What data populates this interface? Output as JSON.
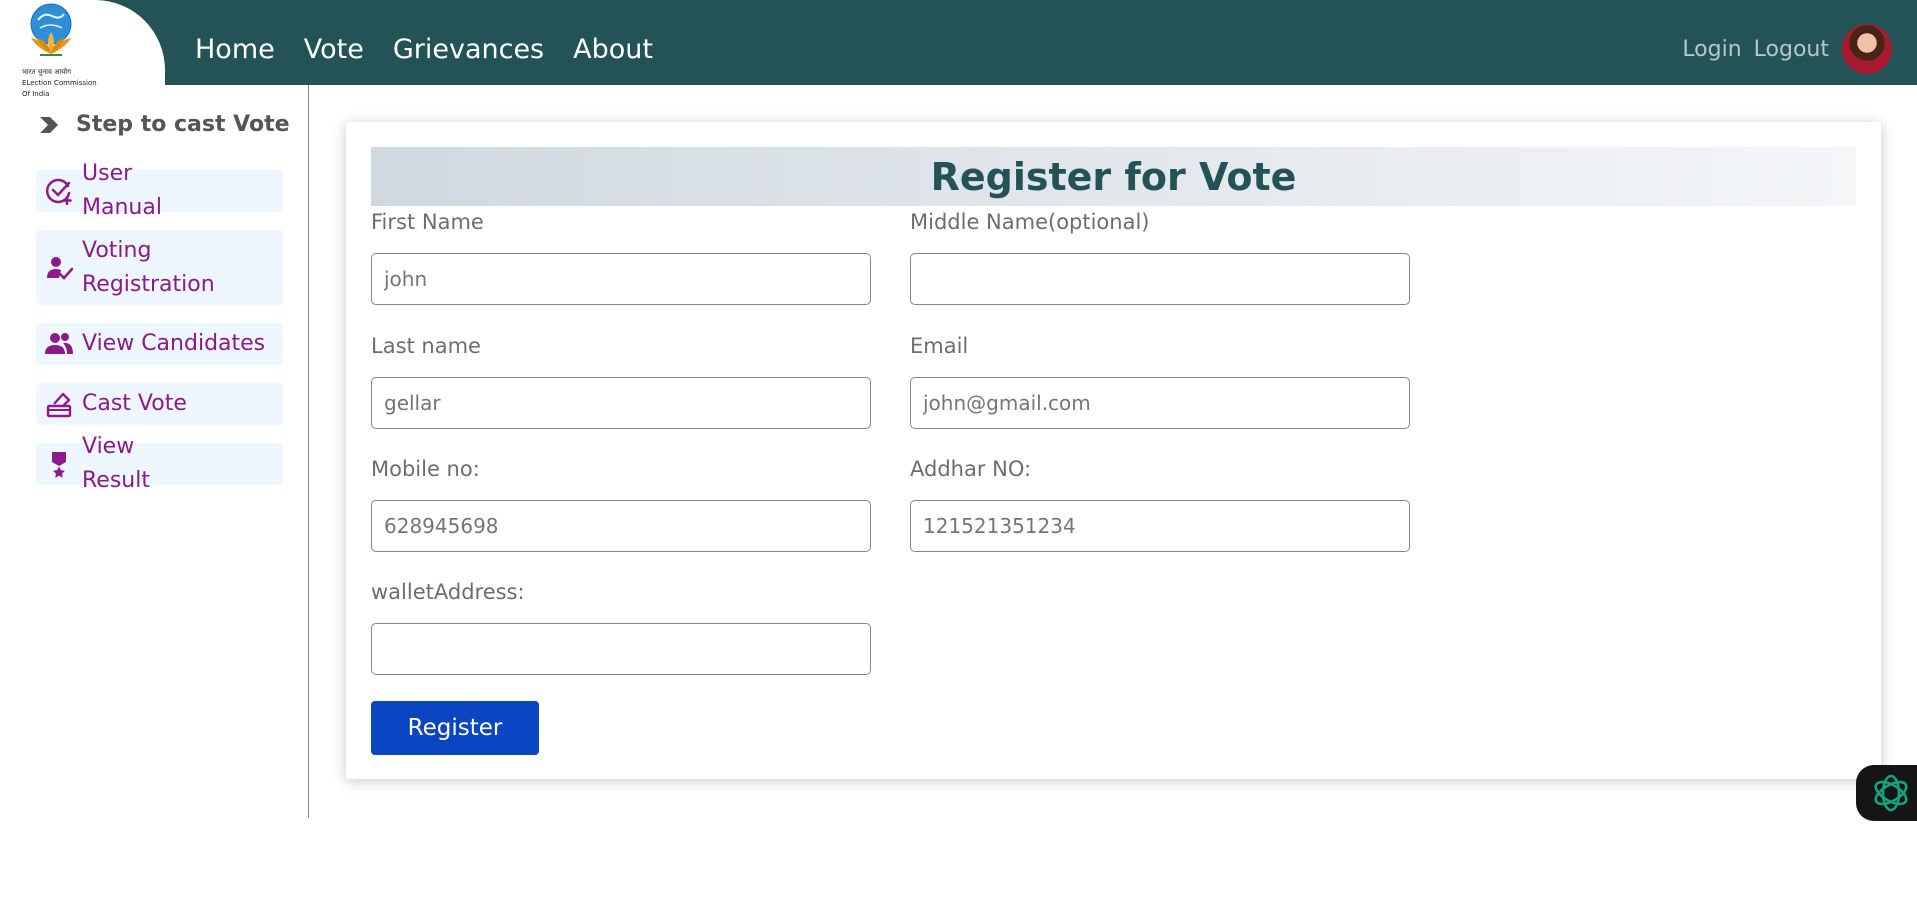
{
  "brand": {
    "logo_line1": "भारत चुनाव आयोग",
    "logo_line2": "ELection Commission",
    "logo_line3": "Of India"
  },
  "nav": {
    "links": [
      "Home",
      "Vote",
      "Grievances",
      "About"
    ],
    "login": "Login",
    "logout": "Logout"
  },
  "sidebar": {
    "title": "Step to cast Vote",
    "items": [
      {
        "label": "User Manual",
        "icon": "check-circle-plus-icon"
      },
      {
        "label": "Voting Registration",
        "icon": "user-check-icon"
      },
      {
        "label": "View Candidates",
        "icon": "users-icon"
      },
      {
        "label": "Cast Vote",
        "icon": "ballot-box-icon"
      },
      {
        "label": "View Result",
        "icon": "medal-icon"
      }
    ]
  },
  "form": {
    "title": "Register for Vote",
    "first_name": {
      "label": "First Name",
      "placeholder": "john"
    },
    "middle_name": {
      "label": "Middle Name(optional)",
      "placeholder": ""
    },
    "last_name": {
      "label": "Last name",
      "placeholder": "gellar"
    },
    "email": {
      "label": "Email",
      "placeholder": "john@gmail.com"
    },
    "mobile": {
      "label": "Mobile no:",
      "placeholder": "628945698"
    },
    "aadhar": {
      "label": "Addhar NO:",
      "placeholder": "121521351234"
    },
    "wallet": {
      "label": "walletAddress:",
      "placeholder": ""
    },
    "submit": "Register"
  },
  "colors": {
    "navbar": "#235356",
    "sidebar_text": "#8b1b8b",
    "sidebar_bg": "#eef6ff",
    "button": "#0b45c2",
    "title": "#235356"
  }
}
